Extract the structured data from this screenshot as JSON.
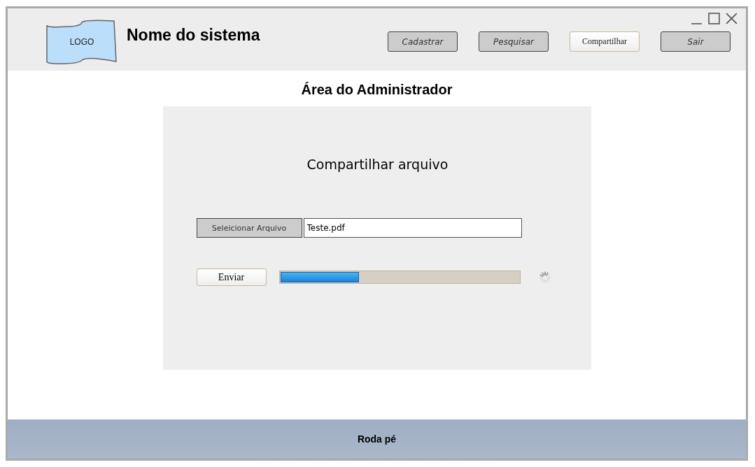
{
  "header": {
    "logo": "LOGO",
    "system_name": "Nome do sistema",
    "nav": [
      {
        "label": "Cadastrar",
        "kind": "sketch"
      },
      {
        "label": "Pesquisar",
        "kind": "sketch"
      },
      {
        "label": "Compartilhar",
        "kind": "plain"
      },
      {
        "label": "Sair",
        "kind": "sketch"
      }
    ]
  },
  "page_title": "Área do Administrador",
  "panel": {
    "title": "Compartilhar arquivo",
    "select_button": "Seleicionar Arquivo",
    "file_value": "Teste.pdf",
    "send_button": "Enviar",
    "progress": {
      "level": 0.33
    }
  },
  "footer": "Roda pé"
}
